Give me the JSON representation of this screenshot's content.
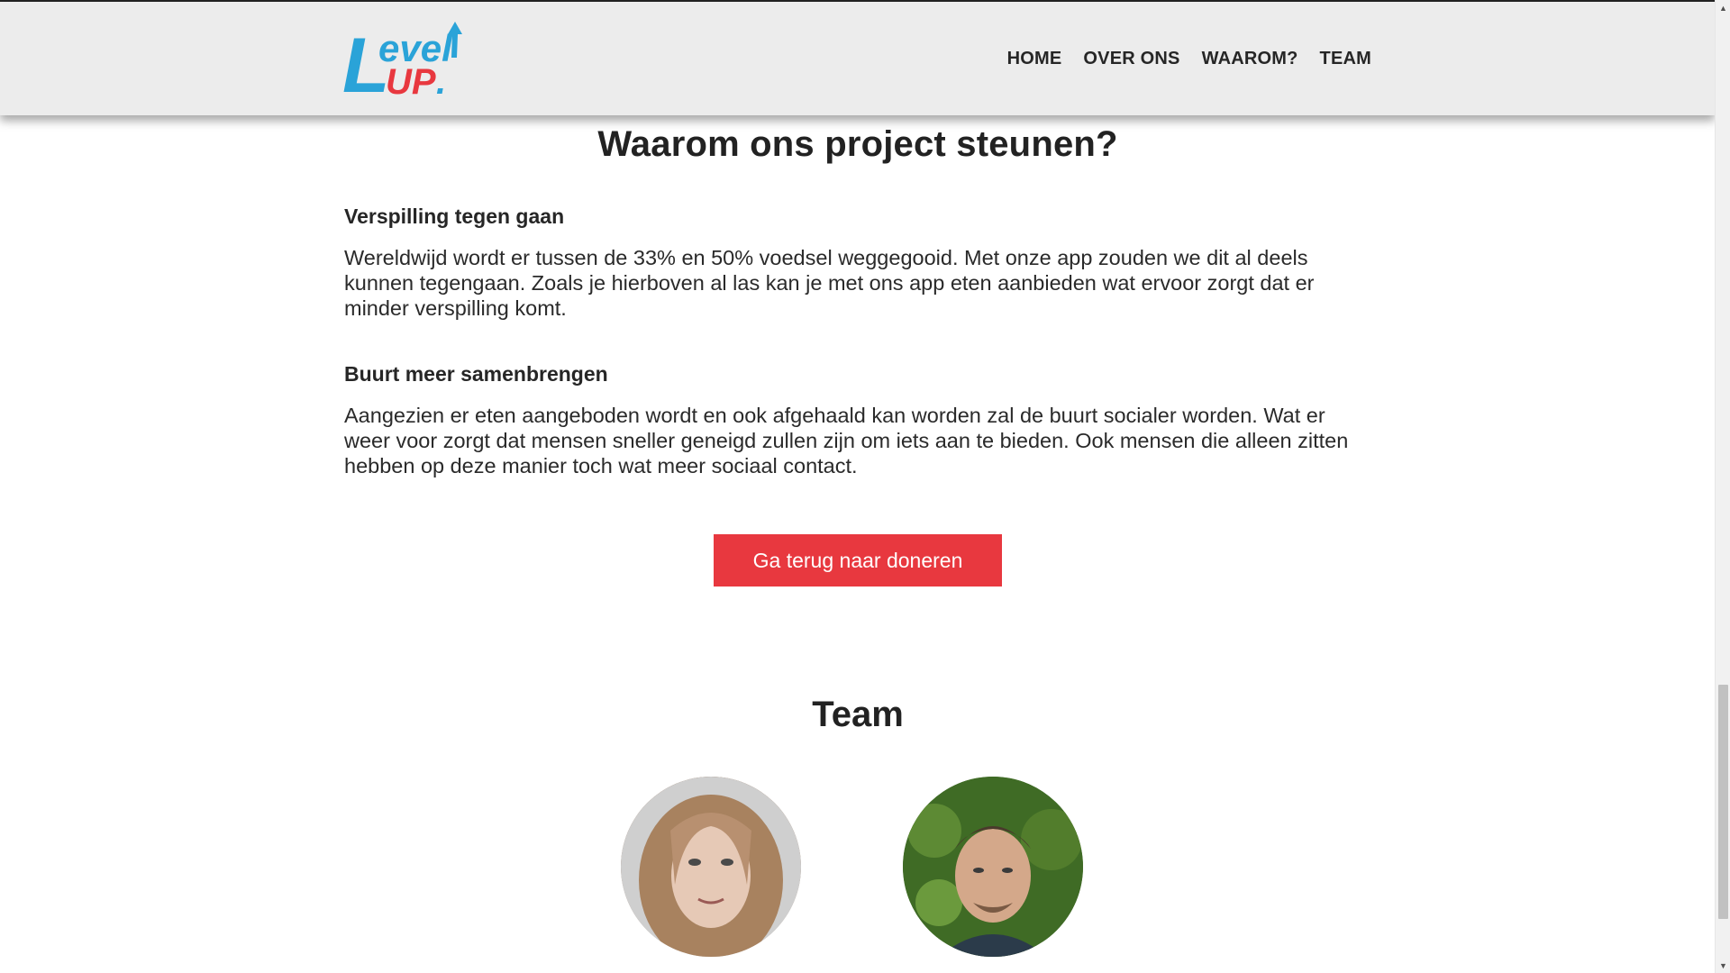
{
  "header": {
    "logo": {
      "line1": "evel",
      "initial": "L",
      "line2": "UP",
      "dot": "."
    },
    "nav": [
      {
        "label": "HOME"
      },
      {
        "label": "OVER ONS"
      },
      {
        "label": "WAAROM?"
      },
      {
        "label": "TEAM"
      }
    ]
  },
  "why": {
    "title": "Waarom ons project steunen?",
    "blocks": [
      {
        "heading": "Verspilling tegen gaan",
        "text": "Wereldwijd wordt er tussen de 33% en 50% voedsel weggegooid. Met onze app zouden we dit al deels kunnen tegengaan. Zoals je hierboven al las kan je met ons app eten aanbieden wat ervoor zorgt dat er minder verspilling komt."
      },
      {
        "heading": "Buurt meer samenbrengen",
        "text": "Aangezien er eten aangeboden wordt en ook afgehaald kan worden zal de buurt socialer worden. Wat er weer voor zorgt dat mensen sneller geneigd zullen zijn om iets aan te bieden. Ook mensen die alleen zitten hebben op deze manier toch wat meer sociaal contact."
      }
    ],
    "button_label": "Ga terug naar doneren"
  },
  "team": {
    "title": "Team"
  },
  "colors": {
    "accent_red": "#e8383f",
    "logo_blue": "#2aa3d8",
    "navbar_bg": "#ececec",
    "text": "#262626"
  }
}
